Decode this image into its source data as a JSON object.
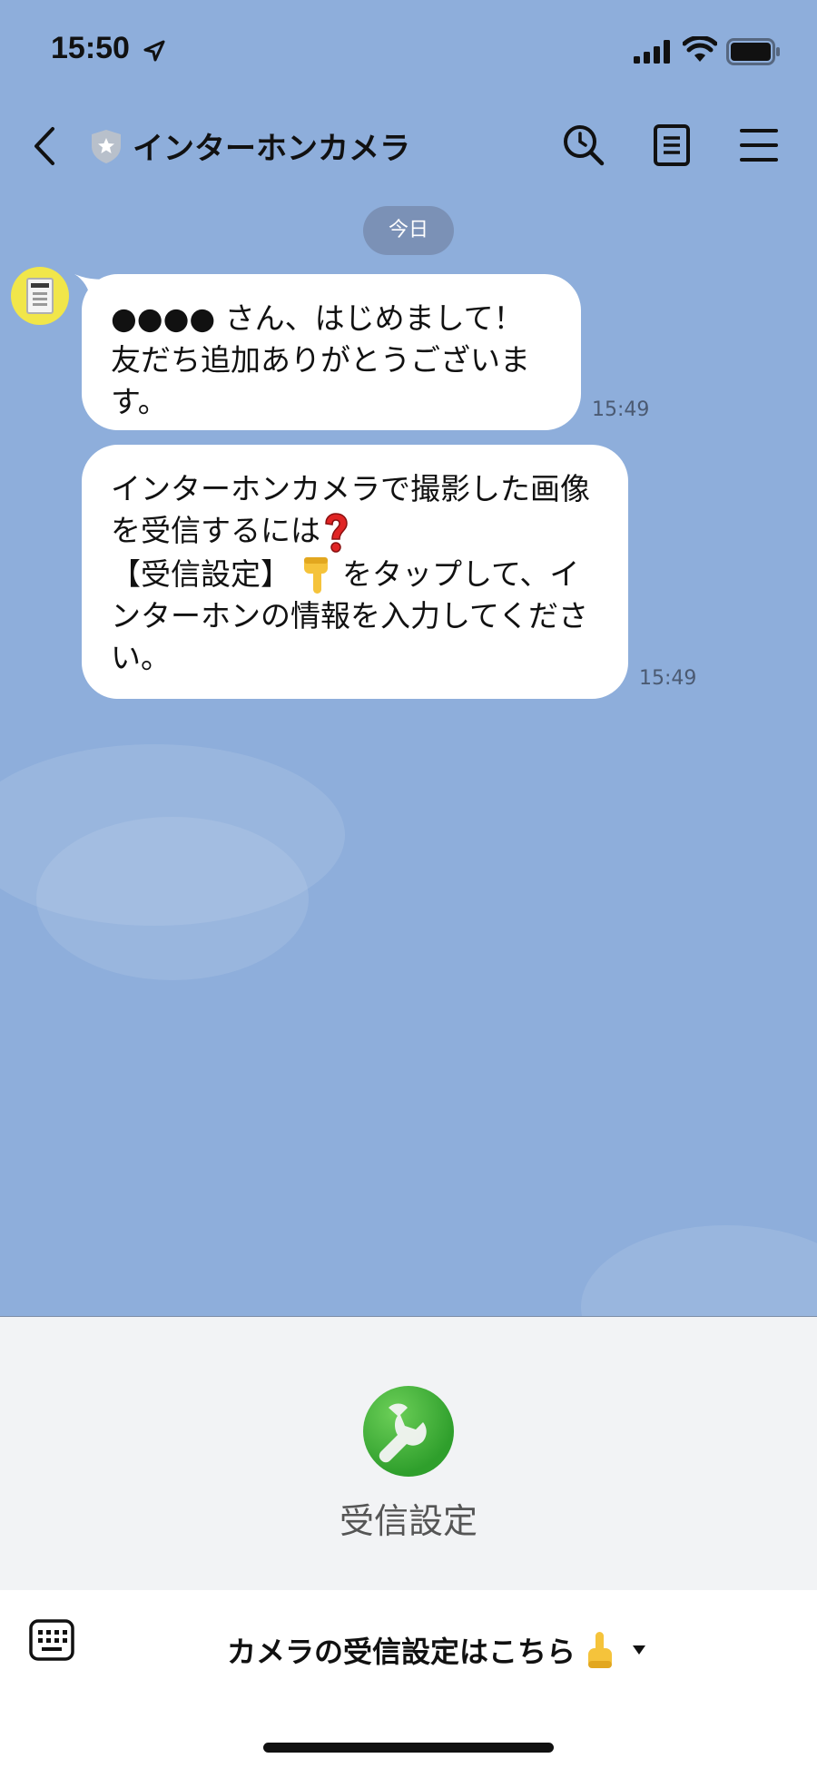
{
  "status_bar": {
    "time": "15:50"
  },
  "header": {
    "title": "インターホンカメラ",
    "back_icon": "chevron-left-icon",
    "badge_icon": "shield-star-icon",
    "actions": [
      "search-icon",
      "notes-icon",
      "menu-icon"
    ]
  },
  "chat": {
    "date_label": "今日",
    "messages": [
      {
        "text": "●●●● さん、はじめまして！\n友だち追加ありがとうございます。",
        "time": "15:49"
      },
      {
        "line1": "インターホンカメラで撮影した画像を受信するには",
        "line2": "【受信設定】",
        "line3": "をタップして、インターホンの情報を入力してください。",
        "time": "15:49"
      }
    ]
  },
  "rich_menu": {
    "button_label": "受信設定",
    "button_icon": "wrench-icon",
    "accent_color": "#3aa83a"
  },
  "bottom_bar": {
    "menu_label": "カメラの受信設定はこちら",
    "keyboard_icon": "keyboard-icon"
  },
  "colors": {
    "chat_background": "#8eaedb",
    "bubble": "#ffffff",
    "rich_menu_background": "#f2f3f5"
  }
}
